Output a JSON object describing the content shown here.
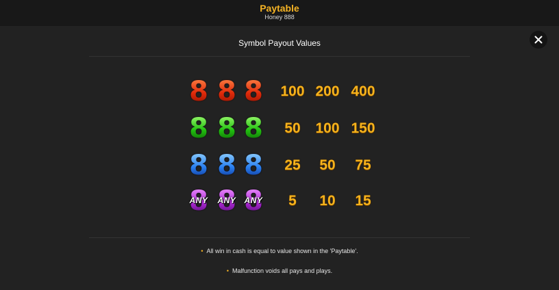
{
  "header": {
    "title": "Paytable",
    "subtitle": "Honey 888"
  },
  "panel": {
    "title": "Symbol Payout Values"
  },
  "paytable": [
    {
      "symbol": "8",
      "color": "#e23a12",
      "any_label": "",
      "payouts": [
        "100",
        "200",
        "400"
      ]
    },
    {
      "symbol": "8",
      "color": "#2fc81e",
      "any_label": "",
      "payouts": [
        "50",
        "100",
        "150"
      ]
    },
    {
      "symbol": "8",
      "color": "#2a8cf0",
      "any_label": "",
      "payouts": [
        "25",
        "50",
        "75"
      ]
    },
    {
      "symbol": "8",
      "color": "#b83adf",
      "any_label": "ANY",
      "payouts": [
        "5",
        "10",
        "15"
      ]
    }
  ],
  "notes": [
    "All win in cash is equal to value shown in the 'Paytable'.",
    "Malfunction voids all pays and plays."
  ],
  "icons": {
    "close": "close-icon"
  },
  "colors": {
    "accent": "#f5b324",
    "background": "#222222",
    "header_background": "#181818"
  }
}
